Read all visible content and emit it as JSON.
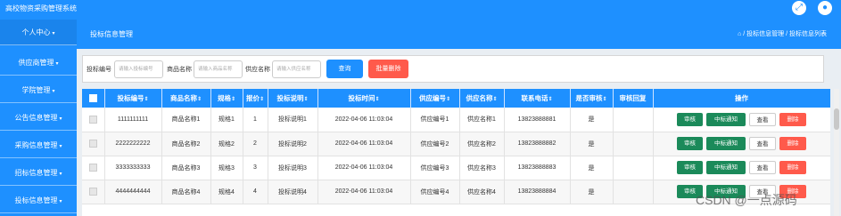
{
  "app": {
    "title": "高校物资采购管理系统",
    "accent": "#1e90ff"
  },
  "topbar_icons": [
    "expand-icon",
    "user-icon"
  ],
  "sidebar": {
    "items": [
      {
        "label": "个人中心"
      },
      {
        "label": "供应商管理"
      },
      {
        "label": "学院管理"
      },
      {
        "label": "公告信息管理"
      },
      {
        "label": "采购信息管理"
      },
      {
        "label": "招标信息管理"
      },
      {
        "label": "投标信息管理"
      }
    ],
    "caret": "▾"
  },
  "header": {
    "page_title": "投标信息管理",
    "breadcrumb": "⌂ / 投标信息管理 / 投标信息列表"
  },
  "search": {
    "fields": [
      {
        "label": "投标编号",
        "placeholder": "请输入投标编号"
      },
      {
        "label": "商品名称",
        "placeholder": "请输入商品名称"
      },
      {
        "label": "供应名称",
        "placeholder": "请输入供应名称"
      }
    ],
    "query_label": "查询",
    "batch_delete_label": "批量删除"
  },
  "table": {
    "columns": [
      "投标编号",
      "商品名称",
      "规格",
      "报价",
      "投标说明",
      "投标时间",
      "供应编号",
      "供应名称",
      "联系电话",
      "是否审核",
      "审核回复",
      "操作"
    ],
    "sort_glyph": "⇕",
    "rows": [
      {
        "code": "1111111111",
        "goods": "商品名称1",
        "spec": "规格1",
        "price": "1",
        "desc": "投标说明1",
        "time": "2022-04-06 11:03:04",
        "sup_code": "供应编号1",
        "sup_name": "供应名称1",
        "phone": "13823888881",
        "audited": "是",
        "reply": ""
      },
      {
        "code": "2222222222",
        "goods": "商品名称2",
        "spec": "规格2",
        "price": "2",
        "desc": "投标说明2",
        "time": "2022-04-06 11:03:04",
        "sup_code": "供应编号2",
        "sup_name": "供应名称2",
        "phone": "13823888882",
        "audited": "是",
        "reply": ""
      },
      {
        "code": "3333333333",
        "goods": "商品名称3",
        "spec": "规格3",
        "price": "3",
        "desc": "投标说明3",
        "time": "2022-04-06 11:03:04",
        "sup_code": "供应编号3",
        "sup_name": "供应名称3",
        "phone": "13823888883",
        "audited": "是",
        "reply": ""
      },
      {
        "code": "4444444444",
        "goods": "商品名称4",
        "spec": "规格4",
        "price": "4",
        "desc": "投标说明4",
        "time": "2022-04-06 11:03:04",
        "sup_code": "供应编号4",
        "sup_name": "供应名称4",
        "phone": "13823888884",
        "audited": "是",
        "reply": ""
      }
    ],
    "actions": {
      "audit": "审核",
      "notify": "中标通知",
      "view": "查看",
      "delete": "删除"
    }
  },
  "watermark": "CSDN @一点源码"
}
